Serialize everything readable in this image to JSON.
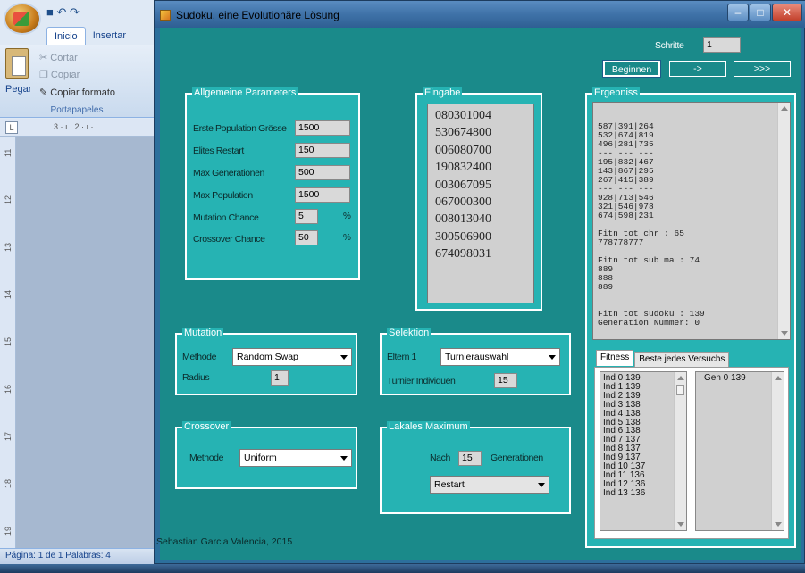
{
  "word": {
    "tabs": [
      "Inicio",
      "Insertar"
    ],
    "ribbon": {
      "paste": "Pegar",
      "cut": "Cortar",
      "copy": "Copiar",
      "format": "Copiar formato",
      "group": "Portapapeles"
    },
    "ruler_h": "3 · ı · 2 · ı ·",
    "ruler_tab": "L",
    "ruler_v": [
      "11",
      "12",
      "13",
      "14",
      "15",
      "16",
      "17",
      "18",
      "19"
    ],
    "status": "Página: 1 de 1   Palabras: 4"
  },
  "window": {
    "title": "Sudoku, eine Evolutionäre Lösung",
    "controls": {
      "minimize": "–",
      "maximize": "□",
      "close": "✕"
    }
  },
  "schritte": {
    "label": "Schritte",
    "value": "1"
  },
  "buttons": {
    "start": "Beginnen",
    "step": "->",
    "fast": ">>>"
  },
  "params": {
    "title": "Allgemeine Parameters",
    "items": [
      {
        "label": "Erste Population Grösse",
        "value": "1500"
      },
      {
        "label": "Elites Restart",
        "value": "150"
      },
      {
        "label": "Max Generationen",
        "value": "500"
      },
      {
        "label": "Max Population",
        "value": "1500"
      },
      {
        "label": "Mutation Chance",
        "value": "5",
        "unit": "%"
      },
      {
        "label": "Crossover Chance",
        "value": "50",
        "unit": "%"
      }
    ]
  },
  "eingabe": {
    "title": "Eingabe",
    "rows": [
      "080301004",
      "530674800",
      "006080700",
      "190832400",
      "003067095",
      "067000300",
      "008013040",
      "300506900",
      "674098031"
    ]
  },
  "ergebnis": {
    "title": "Ergebniss",
    "text": "587|391|264\n532|674|819\n496|281|735\n--- --- ---\n195|832|467\n143|867|295\n267|415|389\n--- --- ---\n928|713|546\n321|546|978\n674|598|231\n\nFitn tot chr : 65\n778778777\n\nFitn tot sub ma : 74\n889\n888\n889\n\n\nFitn tot sudoku : 139\nGeneration Nummer: 0"
  },
  "mutation": {
    "title": "Mutation",
    "method_label": "Methode",
    "method_value": "Random Swap",
    "radius_label": "Radius",
    "radius_value": "1"
  },
  "selektion": {
    "title": "Selektion",
    "eltern_label": "Eltern 1",
    "eltern_value": "Turnierauswahl",
    "turnier_label": "Turnier Individuen",
    "turnier_value": "15"
  },
  "crossover": {
    "title": "Crossover",
    "method_label": "Methode",
    "method_value": "Uniform"
  },
  "lokales": {
    "title": "Lakales Maximum",
    "nach_label": "Nach",
    "nach_value": "15",
    "gen_label": "Generationen",
    "action_value": "Restart"
  },
  "fitness_tabs": [
    "Fitness",
    "Beste jedes Versuchs"
  ],
  "fitness_list": [
    "Ind 0 139",
    "Ind 1 139",
    "Ind 2 139",
    "Ind 3 138",
    "Ind 4 138",
    "Ind 5 138",
    "Ind 6 138",
    "Ind 7 137",
    "Ind 8 137",
    "Ind 9 137",
    "Ind 10 137",
    "Ind 11 136",
    "Ind 12 136",
    "Ind 13 136"
  ],
  "generation_list": [
    "Gen 0 139"
  ],
  "credit": "Sebastian Garcia Valencia, 2015"
}
